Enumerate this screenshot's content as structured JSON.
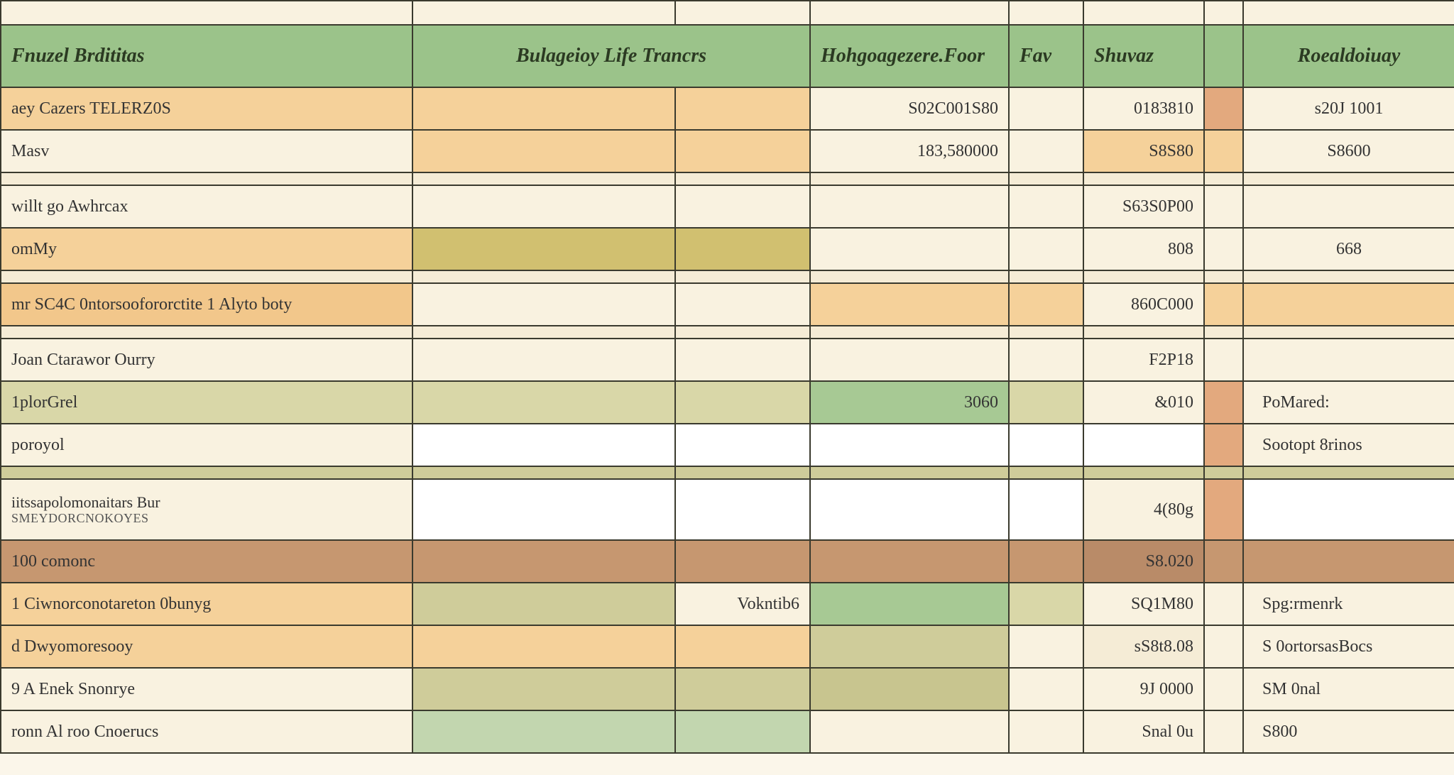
{
  "headers": {
    "c0": "Fnuzel Brdititas",
    "c12": "Bulageioy Life Trancrs",
    "c3": "Hohgoagezere.Foor",
    "c4": "Fav",
    "c5": "Shuvaz",
    "c7": "Roealdoiuay"
  },
  "rows": [
    {
      "id": "r1",
      "label": "aey Cazers TELERZ0S",
      "c3": "S02C001S80",
      "c5": "0183810",
      "c7": "s20J 1001"
    },
    {
      "id": "r2",
      "label": "Masv",
      "c3": "183,580000",
      "c5": "S8S80",
      "c7": "S8600"
    },
    {
      "id": "r3",
      "label": "willt go Awhrcax",
      "c3": "",
      "c5": "S63S0P00",
      "c7": ""
    },
    {
      "id": "r4",
      "label": "omMy",
      "c3": "",
      "c5": "808",
      "c7": "668"
    },
    {
      "id": "r5",
      "label": "mr SC4C 0ntorsoofororctite 1 Alyto boty",
      "c3": "",
      "c5": "860C000",
      "c7": ""
    },
    {
      "id": "r6",
      "label": "Joan Ctarawor Ourry",
      "c3": "",
      "c5": "F2P18",
      "c7": ""
    },
    {
      "id": "r7",
      "label": "1plorGrel",
      "c3": "3060",
      "c5": "&010",
      "c7": "PoMared:"
    },
    {
      "id": "r8",
      "label": "poroyol",
      "c3": "",
      "c5": "",
      "c7": "Sootopt 8rinos"
    },
    {
      "id": "r9",
      "label": "iitssapolomonaitars Bur",
      "sub": "SMEYDORCNOKOYES",
      "c3": "",
      "c5": "4(80g",
      "c7": ""
    },
    {
      "id": "r10",
      "label": "100 comonc",
      "c3": "",
      "c5": "S8.020",
      "c7": ""
    },
    {
      "id": "r11",
      "label": "1 Ciwnorconotareton 0bunyg",
      "c2": "Vokntib6",
      "c3": "",
      "c5": "SQ1M80",
      "c7": "Spg:rmenrk"
    },
    {
      "id": "r12",
      "label": "d Dwyomoresooy",
      "c3": "",
      "c5": "sS8t8.08",
      "c7": "S 0ortorsasBocs"
    },
    {
      "id": "r13",
      "label": "9 A Enek Snonrye",
      "c3": "",
      "c5": "9J 0000",
      "c7": "SM 0nal"
    },
    {
      "id": "r14",
      "label": "ronn Al roo Cnoerucs",
      "c3": "",
      "c5": "Snal 0u",
      "c7": "S800"
    }
  ]
}
